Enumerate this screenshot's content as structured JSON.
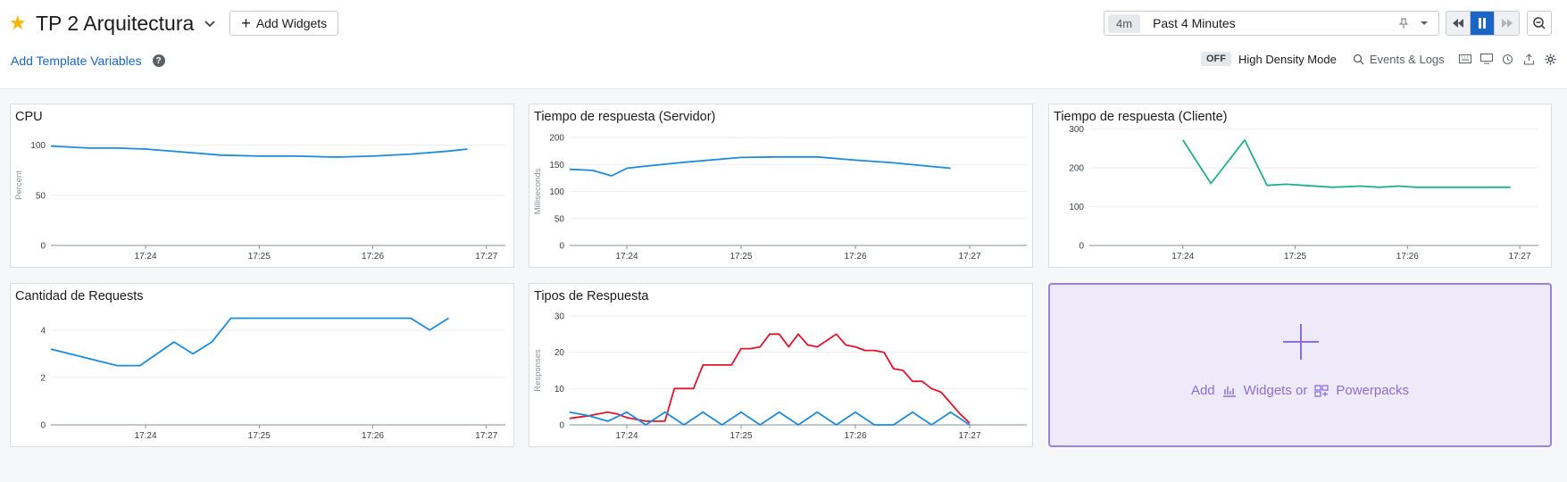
{
  "dashboard": {
    "title": "TP 2 Arquitectura",
    "add_widgets_label": "Add Widgets",
    "template_variables_label": "Add Template Variables",
    "help_glyph": "?"
  },
  "time_picker": {
    "badge": "4m",
    "label": "Past 4 Minutes"
  },
  "toolbar": {
    "density_state": "OFF",
    "density_label": "High Density Mode",
    "events_label": "Events & Logs"
  },
  "colors": {
    "blue": "#1b8be0",
    "green": "#1fb08a",
    "red": "#e0162b",
    "accent": "#1a66c7",
    "purple": "#8b6fd6"
  },
  "add_tile": {
    "add_label": "Add",
    "widgets_label": "Widgets or",
    "powerpacks_label": "Powerpacks"
  },
  "chart_data": [
    {
      "id": "cpu",
      "title": "CPU",
      "type": "line",
      "ylabel": "Percent",
      "xlabel": "",
      "ylim": [
        0,
        120
      ],
      "yticks": [
        0,
        50,
        100
      ],
      "xlim": [
        0,
        240
      ],
      "xticks": [
        {
          "v": 50,
          "label": "17:24"
        },
        {
          "v": 110,
          "label": "17:25"
        },
        {
          "v": 170,
          "label": "17:26"
        },
        {
          "v": 230,
          "label": "17:27"
        }
      ],
      "series": [
        {
          "color": "#1b8be0",
          "x": [
            0,
            20,
            35,
            50,
            70,
            90,
            110,
            130,
            150,
            170,
            190,
            210,
            220
          ],
          "y": [
            99,
            97,
            97,
            96,
            93,
            90,
            89,
            89,
            88,
            89,
            91,
            94,
            96
          ]
        }
      ]
    },
    {
      "id": "server",
      "title": "Tiempo de respuesta (Servidor)",
      "type": "line",
      "ylabel": "Milliseconds",
      "xlabel": "",
      "ylim": [
        0,
        200
      ],
      "yticks": [
        0,
        50,
        100,
        150,
        200
      ],
      "xlim": [
        0,
        240
      ],
      "xticks": [
        {
          "v": 30,
          "label": "17:24"
        },
        {
          "v": 90,
          "label": "17:25"
        },
        {
          "v": 150,
          "label": "17:26"
        },
        {
          "v": 210,
          "label": "17:27"
        }
      ],
      "series": [
        {
          "color": "#1b8be0",
          "x": [
            0,
            12,
            22,
            30,
            40,
            60,
            90,
            110,
            130,
            150,
            170,
            185,
            200
          ],
          "y": [
            141,
            139,
            129,
            143,
            147,
            154,
            163,
            164,
            164,
            158,
            153,
            148,
            143
          ]
        }
      ]
    },
    {
      "id": "client",
      "title": "Tiempo de respuesta (Cliente)",
      "type": "line",
      "ylabel": "",
      "xlabel": "",
      "ylim": [
        0,
        320
      ],
      "yticks": [
        0,
        100,
        200,
        300
      ],
      "xlim": [
        0,
        240
      ],
      "xticks": [
        {
          "v": 50,
          "label": "17:24"
        },
        {
          "v": 110,
          "label": "17:25"
        },
        {
          "v": 170,
          "label": "17:26"
        },
        {
          "v": 230,
          "label": "17:27"
        }
      ],
      "series": [
        {
          "color": "#1fb08a",
          "x": [
            50,
            65,
            83,
            95,
            105,
            115,
            130,
            145,
            155,
            165,
            175,
            190,
            210,
            225
          ],
          "y": [
            272,
            160,
            272,
            155,
            158,
            155,
            150,
            153,
            150,
            153,
            150,
            150,
            150,
            150
          ]
        }
      ]
    },
    {
      "id": "requests",
      "title": "Cantidad de Requests",
      "type": "line",
      "ylabel": "",
      "xlabel": "",
      "ylim": [
        0,
        5.5
      ],
      "yticks": [
        0,
        2,
        4
      ],
      "xlim": [
        0,
        240
      ],
      "xticks": [
        {
          "v": 50,
          "label": "17:24"
        },
        {
          "v": 110,
          "label": "17:25"
        },
        {
          "v": 170,
          "label": "17:26"
        },
        {
          "v": 230,
          "label": "17:27"
        }
      ],
      "series": [
        {
          "color": "#1b8be0",
          "x": [
            0,
            35,
            47,
            65,
            75,
            85,
            95,
            110,
            150,
            190,
            200,
            210
          ],
          "y": [
            3.2,
            2.5,
            2.5,
            3.5,
            3.0,
            3.5,
            4.5,
            4.5,
            4.5,
            4.5,
            4.0,
            4.5
          ]
        }
      ]
    },
    {
      "id": "tipos",
      "title": "Tipos de Respuesta",
      "type": "line",
      "ylabel": "Responses",
      "xlabel": "",
      "ylim": [
        0,
        30
      ],
      "yticks": [
        0,
        10,
        20,
        30
      ],
      "xlim": [
        0,
        240
      ],
      "xticks": [
        {
          "v": 30,
          "label": "17:24"
        },
        {
          "v": 90,
          "label": "17:25"
        },
        {
          "v": 150,
          "label": "17:26"
        },
        {
          "v": 210,
          "label": "17:27"
        }
      ],
      "series": [
        {
          "color": "#e0162b",
          "x": [
            0,
            10,
            20,
            25,
            30,
            35,
            40,
            50,
            55,
            60,
            65,
            70,
            75,
            80,
            85,
            90,
            95,
            100,
            105,
            110,
            115,
            120,
            125,
            130,
            140,
            145,
            150,
            155,
            160,
            165,
            170,
            175,
            180,
            185,
            190,
            195,
            200,
            205,
            210
          ],
          "y": [
            1.8,
            2.5,
            3.5,
            3.0,
            2.0,
            1.5,
            1.0,
            1.0,
            10,
            10,
            10,
            16.5,
            16.5,
            16.5,
            16.5,
            21,
            21,
            21.5,
            25,
            25,
            21.5,
            25,
            22,
            21.5,
            25,
            22,
            21.5,
            20.5,
            20.5,
            20,
            15.5,
            15,
            12,
            12,
            10,
            9,
            6,
            3,
            0.5
          ]
        },
        {
          "color": "#1b8be0",
          "x": [
            0,
            10,
            20,
            30,
            40,
            50,
            60,
            70,
            80,
            90,
            100,
            110,
            120,
            130,
            140,
            150,
            160,
            170,
            180,
            190,
            200,
            210
          ],
          "y": [
            3.5,
            2.5,
            1.0,
            3.5,
            0.0,
            3.5,
            0.0,
            3.5,
            0.0,
            3.5,
            0.0,
            3.5,
            0.0,
            3.5,
            0.0,
            3.5,
            0.0,
            0.0,
            3.5,
            0.0,
            3.5,
            0.0
          ]
        }
      ]
    }
  ]
}
